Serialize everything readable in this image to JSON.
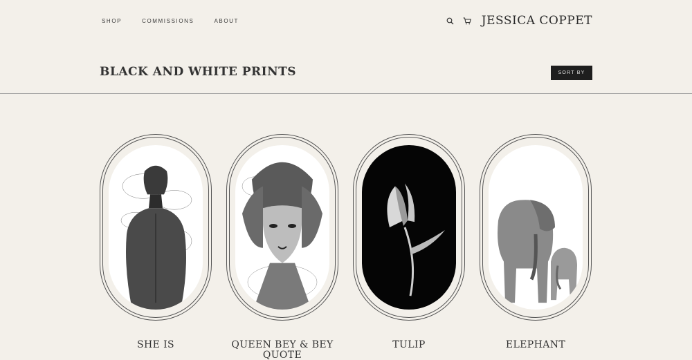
{
  "nav": {
    "items": [
      {
        "label": "SHOP"
      },
      {
        "label": "COMMISSIONS"
      },
      {
        "label": "ABOUT"
      }
    ]
  },
  "header": {
    "brand": "JESSICA COPPET",
    "icons": [
      "search-icon",
      "cart-icon"
    ]
  },
  "collection": {
    "title": "BLACK AND WHITE PRINTS",
    "sort_label": "SORT BY"
  },
  "products": [
    {
      "title": "SHE IS"
    },
    {
      "title": "QUEEN BEY & BEY QUOTE"
    },
    {
      "title": "TULIP"
    },
    {
      "title": "ELEPHANT"
    }
  ],
  "colors": {
    "background": "#f3f0ea",
    "button": "#1e1e1e",
    "text": "#2a2a2a"
  }
}
